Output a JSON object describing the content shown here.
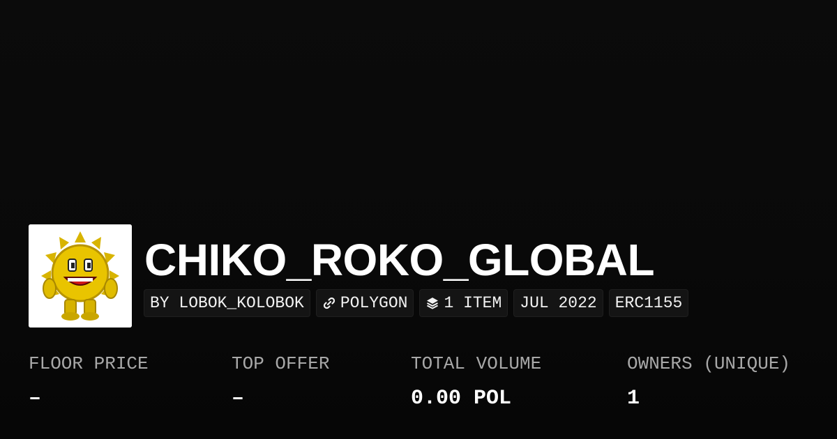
{
  "collection": {
    "title": "CHIKO_ROKO_GLOBAL"
  },
  "chips": {
    "creator": "BY LOBOK_KOLOBOK",
    "chain": "POLYGON",
    "items": "1 ITEM",
    "date": "JUL 2022",
    "standard": "ERC1155"
  },
  "icons": {
    "chain": "link-icon",
    "items": "layers-icon",
    "avatar": "sun-mascot-image"
  },
  "stats": {
    "floor_price": {
      "label": "FLOOR PRICE",
      "value": "–"
    },
    "top_offer": {
      "label": "TOP OFFER",
      "value": "–"
    },
    "total_volume": {
      "label": "TOTAL VOLUME",
      "value": "0.00 POL"
    },
    "owners": {
      "label": "OWNERS (UNIQUE)",
      "value": "1"
    }
  },
  "colors": {
    "background": "#0a0a0a",
    "chip_background": "#141414",
    "label_gray": "#a8a8a8",
    "text": "#ffffff"
  }
}
